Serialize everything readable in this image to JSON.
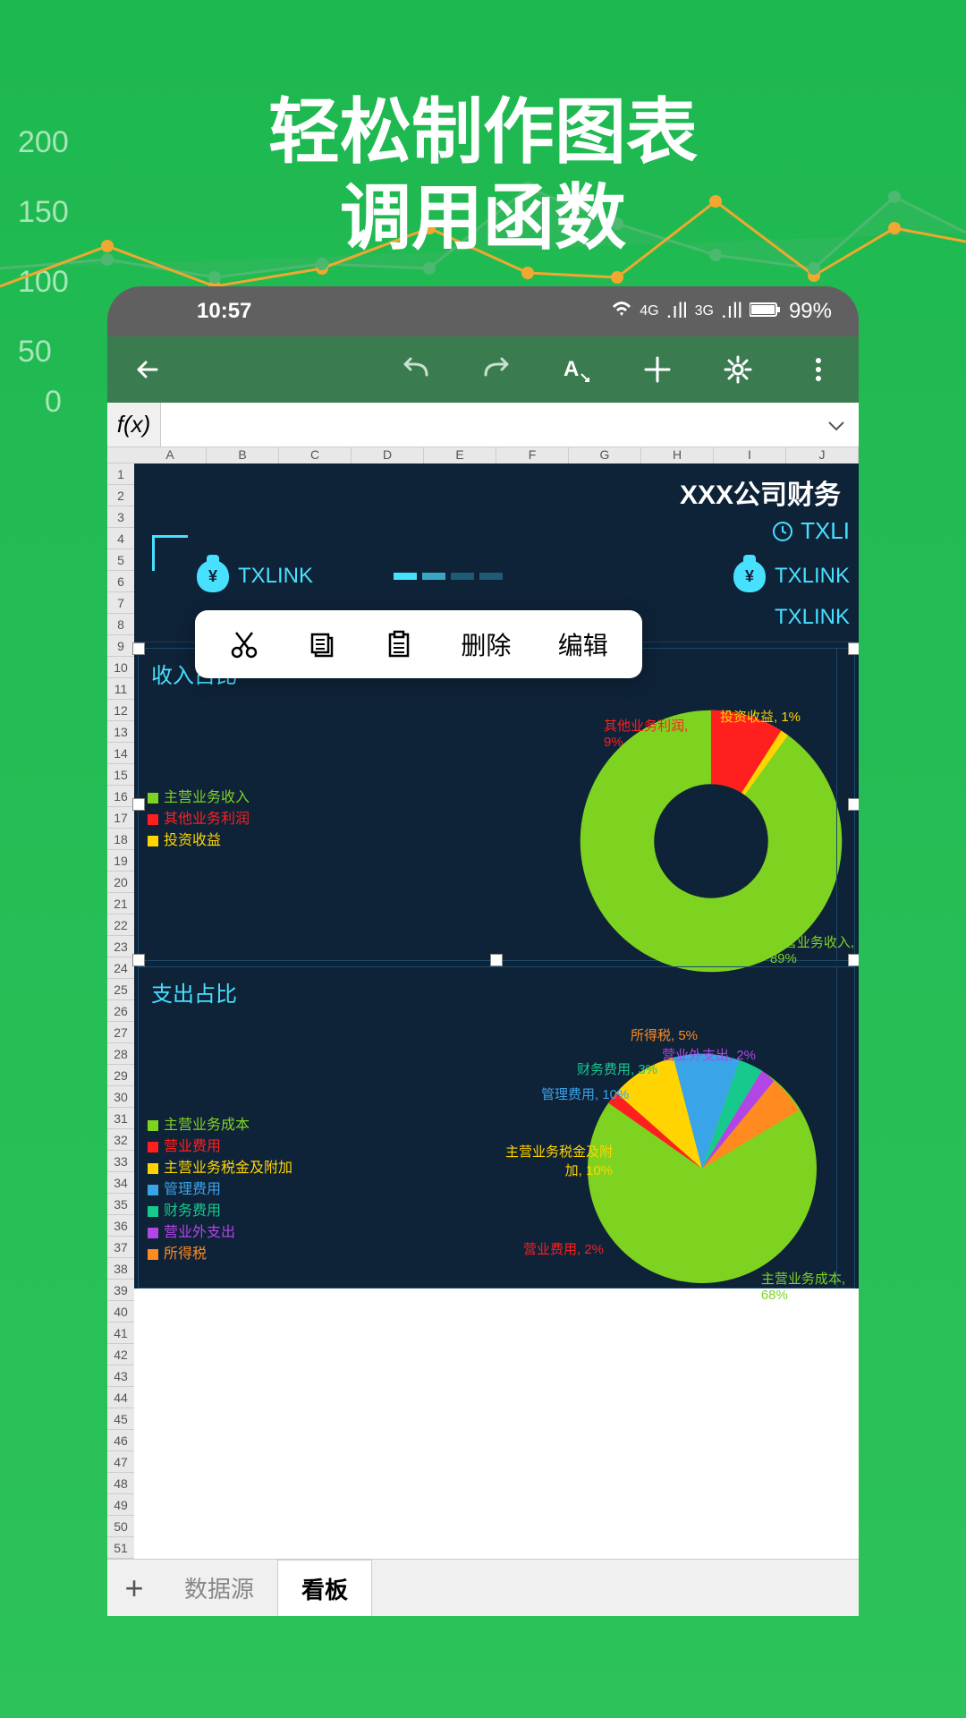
{
  "headline": {
    "line1": "轻松制作图表",
    "line2": "调用函数"
  },
  "bg_axis": [
    "200",
    "150",
    "100",
    "50",
    "0"
  ],
  "statusbar": {
    "time": "10:57",
    "net1": "4G",
    "net2": "3G",
    "battery": "99%"
  },
  "fxbar": {
    "label": "f(x)"
  },
  "columns": [
    "A",
    "B",
    "C",
    "D",
    "E",
    "F",
    "G",
    "H",
    "I",
    "J"
  ],
  "rows_visible": 51,
  "dashboard": {
    "title": "XXX公司财务",
    "link1": "TXLINK",
    "link2": "TXLINK",
    "link3": "TXLINK",
    "top_right": "TXLI"
  },
  "context_menu": {
    "cut": "✂",
    "copy": "⧉",
    "paste": "📋",
    "delete": "删除",
    "edit": "编辑"
  },
  "tabs": {
    "add": "+",
    "tab1": "数据源",
    "tab2": "看板"
  },
  "chart1": {
    "title": "收入占比",
    "legend": [
      {
        "label": "主营业务收入",
        "color": "#7ed321"
      },
      {
        "label": "其他业务利润",
        "color": "#ff1f1f"
      },
      {
        "label": "投资收益",
        "color": "#ffd400"
      }
    ],
    "labels": [
      {
        "text": "主营业务收入,",
        "sub": "89%",
        "color": "#7ed321"
      },
      {
        "text": "其他业务利润,",
        "sub": "9%",
        "color": "#ff1f1f"
      },
      {
        "text": "投资收益,",
        "sub": "1%",
        "color": "#ffd400"
      }
    ]
  },
  "chart2": {
    "title": "支出占比",
    "legend": [
      {
        "label": "主营业务成本",
        "color": "#7ed321"
      },
      {
        "label": "营业费用",
        "color": "#ff1f1f"
      },
      {
        "label": "主营业务税金及附加",
        "color": "#ffd400"
      },
      {
        "label": "管理费用",
        "color": "#3aa4e8"
      },
      {
        "label": "财务费用",
        "color": "#18c98e"
      },
      {
        "label": "营业外支出",
        "color": "#b345e6"
      },
      {
        "label": "所得税",
        "color": "#ff8a1f"
      }
    ],
    "labels": [
      {
        "text": "主营业务成本,",
        "sub": "68%",
        "color": "#7ed321"
      },
      {
        "text": "营业费用,",
        "sub": "2%",
        "color": "#ff1f1f"
      },
      {
        "text": "主营业务税金及附",
        "sub": "加, 10%",
        "color": "#ffd400"
      },
      {
        "text": "管理费用,",
        "sub": "10%",
        "color": "#3aa4e8"
      },
      {
        "text": "财务费用,",
        "sub": "3%",
        "color": "#18c98e"
      },
      {
        "text": "营业外支出,",
        "sub": "2%",
        "color": "#b345e6"
      },
      {
        "text": "所得税,",
        "sub": "5%",
        "color": "#ff8a1f"
      }
    ]
  },
  "chart_data": [
    {
      "type": "pie",
      "title": "收入占比",
      "series": [
        {
          "name": "收入占比",
          "values": [
            89,
            9,
            1
          ]
        }
      ],
      "categories": [
        "主营业务收入",
        "其他业务利润",
        "投资收益"
      ]
    },
    {
      "type": "pie",
      "title": "支出占比",
      "series": [
        {
          "name": "支出占比",
          "values": [
            68,
            2,
            10,
            10,
            3,
            2,
            5
          ]
        }
      ],
      "categories": [
        "主营业务成本",
        "营业费用",
        "主营业务税金及附加",
        "管理费用",
        "财务费用",
        "营业外支出",
        "所得税"
      ]
    }
  ]
}
